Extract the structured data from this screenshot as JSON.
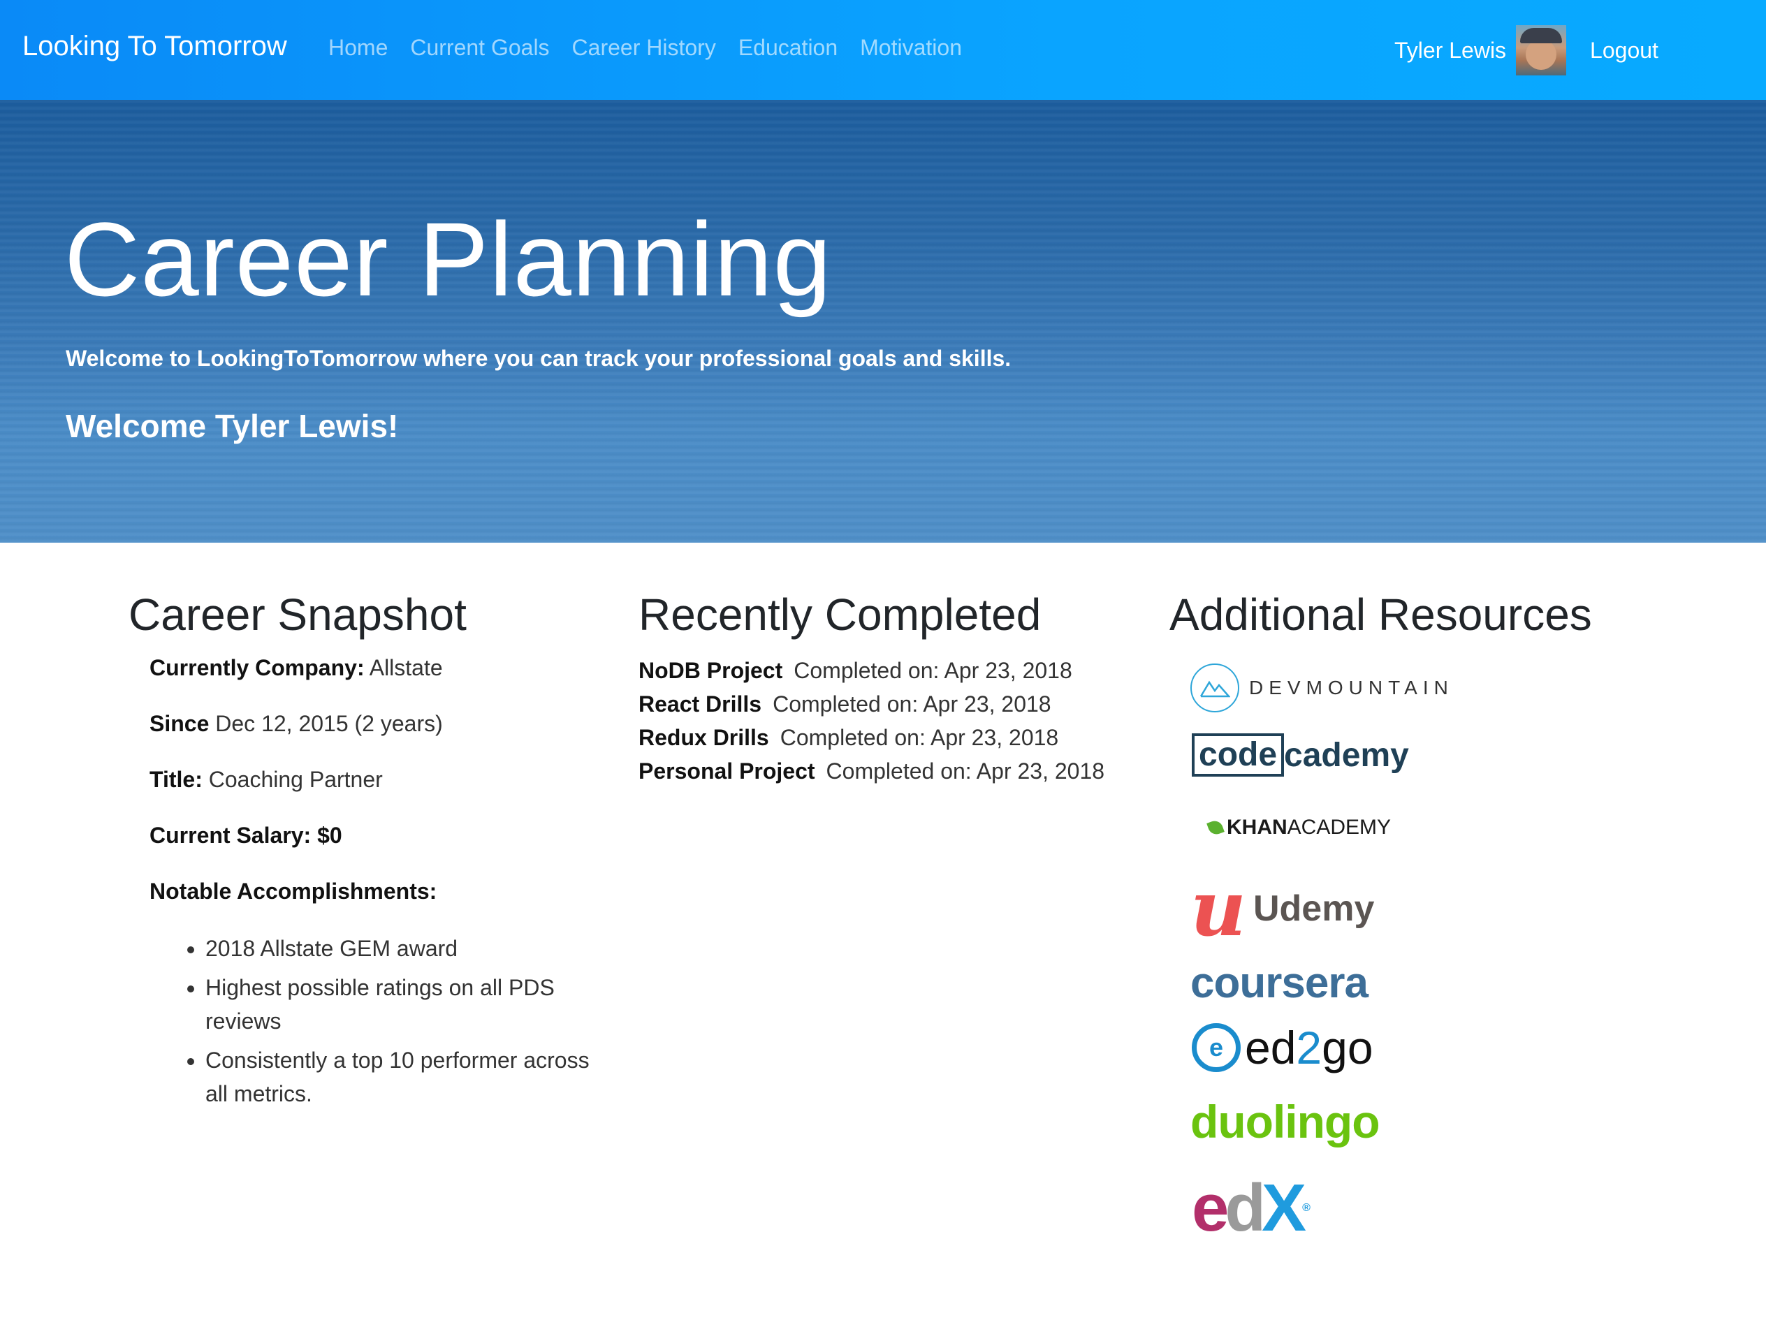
{
  "nav": {
    "brand": "Looking To Tomorrow",
    "links": [
      "Home",
      "Current Goals",
      "Career History",
      "Education",
      "Motivation"
    ],
    "user_name": "Tyler Lewis",
    "logout_label": "Logout"
  },
  "hero": {
    "title": "Career Planning",
    "subtitle": "Welcome to LookingToTomorrow where you can track your professional goals and skills.",
    "welcome": "Welcome Tyler Lewis!"
  },
  "snapshot": {
    "title": "Career Snapshot",
    "company_label": "Currently Company:",
    "company_value": "Allstate",
    "since_label": "Since",
    "since_value": "Dec 12, 2015 (2 years)",
    "title_label": "Title:",
    "title_value": "Coaching Partner",
    "salary_label": "Current Salary:",
    "salary_value": "$0",
    "accomplishments_label": "Notable Accomplishments:",
    "accomplishments": [
      "2018 Allstate GEM award",
      "Highest possible ratings on all PDS reviews",
      "Consistently a top 10 performer across all metrics."
    ]
  },
  "recent": {
    "title": "Recently Completed",
    "items": [
      {
        "name": "NoDB Project",
        "completed": "Completed on: Apr 23, 2018"
      },
      {
        "name": "React Drills",
        "completed": "Completed on: Apr 23, 2018"
      },
      {
        "name": "Redux Drills",
        "completed": "Completed on: Apr 23, 2018"
      },
      {
        "name": "Personal Project",
        "completed": "Completed on: Apr 23, 2018"
      }
    ]
  },
  "resources": {
    "title": "Additional Resources",
    "logos": {
      "devmountain": "DEVMOUNTAIN",
      "codecademy_box": "code",
      "codecademy_rest": "cademy",
      "khan_bold": "KHAN",
      "khan_rest": "ACADEMY",
      "udemy_mark": "u",
      "udemy_word": "Udemy",
      "coursera": "coursera",
      "ed2go_pre": "ed",
      "ed2go_mid": "2",
      "ed2go_post": "go",
      "duolingo": "duolingo",
      "edx_e": "e",
      "edx_d": "d",
      "edx_x": "X",
      "edx_reg": "®"
    }
  }
}
